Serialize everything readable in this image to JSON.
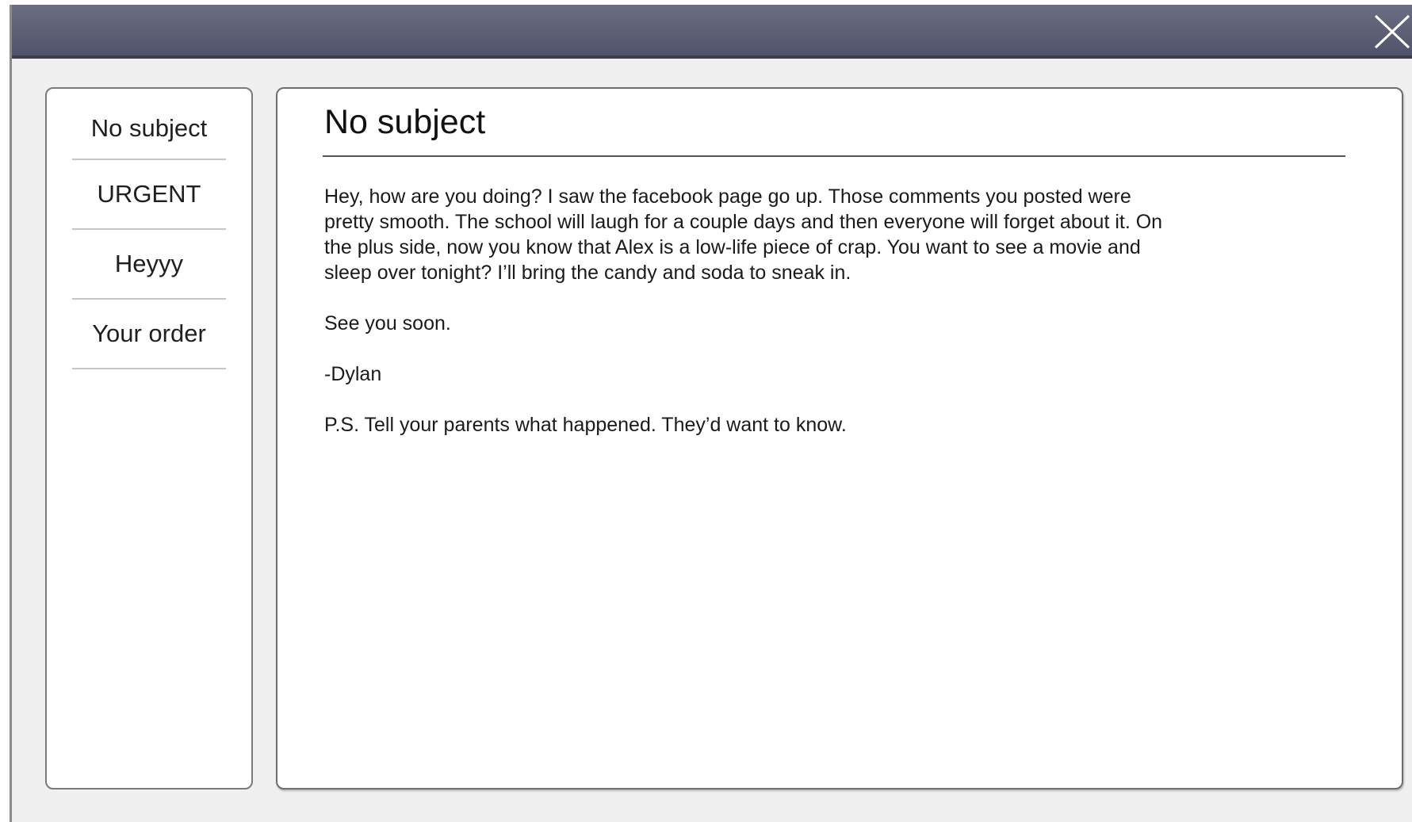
{
  "window": {
    "close_icon": "close-x-icon"
  },
  "inbox": {
    "items": [
      {
        "label": "No subject"
      },
      {
        "label": "URGENT"
      },
      {
        "label": "Heyyy"
      },
      {
        "label": "Your order"
      }
    ]
  },
  "message": {
    "subject": "No subject",
    "paragraphs": [
      "Hey, how are you doing? I saw the facebook page go up. Those comments you posted were pretty smooth. The school will laugh for a couple days and then everyone will forget about it. On the plus side, now you know that Alex is a low-life piece of crap. You want to see a movie and sleep over tonight? I’ll bring the candy and soda to sneak in.",
      "See you soon.",
      "-Dylan",
      "P.S. Tell your parents what happened. They’d want to know."
    ]
  },
  "colors": {
    "titlebar": "#5d6074",
    "window_bg": "#f0f0f0",
    "panel_bg": "#ffffff",
    "panel_border": "#7a7a7a",
    "close_icon": "#ffffff"
  }
}
